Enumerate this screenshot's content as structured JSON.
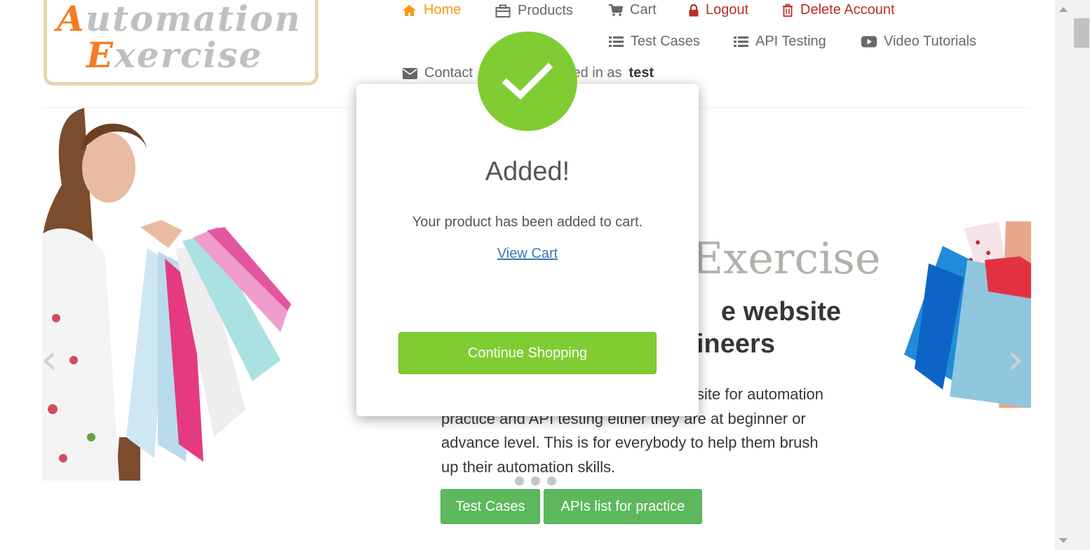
{
  "logo": {
    "line1": "Automation",
    "line2": "Exercise"
  },
  "nav": {
    "home": "Home",
    "products": "Products",
    "cart": "Cart",
    "logout": "Logout",
    "delete_account": "Delete Account",
    "test_cases": "Test Cases",
    "api_testing": "API Testing",
    "video_tutorials": "Video Tutorials",
    "contact": "Contact",
    "logged_in_prefix": "Logged in as",
    "username": "test"
  },
  "hero": {
    "title": "AutomationExercise",
    "title_visible": "Exercise",
    "subtitle": "Full-Fledged practice website for Automation Engineers",
    "subtitle_line1": "e website",
    "subtitle_line2": "ineers",
    "text_line1": "site for automation",
    "text_line2": "practice and API testing either they are at beginner or",
    "text_line3": "advance level. This is for everybody to help them brush",
    "text_line4": "up their automation skills.",
    "btn_test_cases": "Test Cases",
    "btn_apis": "APIs list for practice"
  },
  "modal": {
    "title": "Added!",
    "text": "Your product has been added to cart.",
    "link": "View Cart",
    "button": "Continue Shopping"
  },
  "colors": {
    "accent": "#fe980f",
    "success": "#7fcd33",
    "button_green": "#5cb85c",
    "danger": "#b92c28",
    "link": "#337ab7"
  }
}
